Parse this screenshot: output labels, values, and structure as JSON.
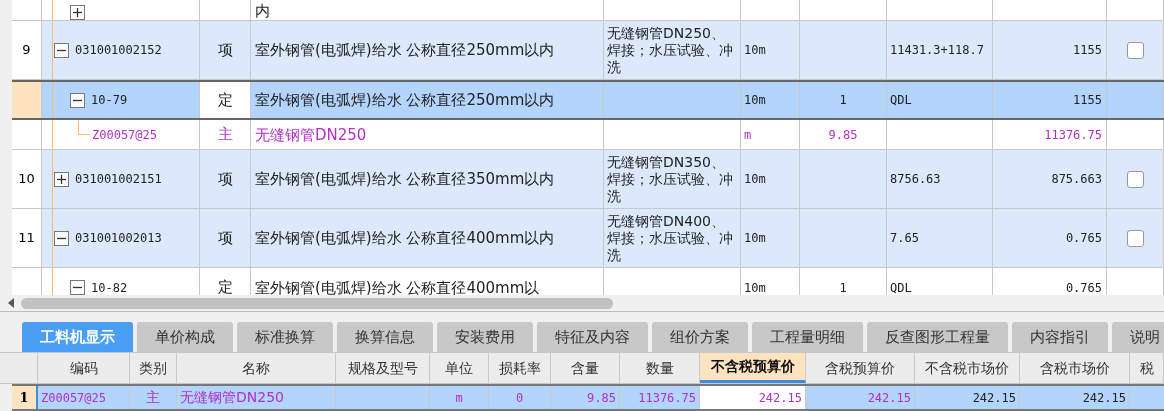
{
  "grid": {
    "rows": [
      {
        "kind": "quota",
        "selected": false,
        "expanded": false,
        "name": "内"
      },
      {
        "kind": "item",
        "number": "9",
        "code": "031001002152",
        "selected": false,
        "expanded": true,
        "checked": false,
        "type": "项",
        "name": "室外钢管(电弧焊)给水 公称直径250mm以内",
        "feature": "无缝钢管DN250、焊接；水压试验、冲洗",
        "unit": "10m",
        "expr": "11431.3+118.7",
        "amount": "1155",
        "children": [
          {
            "kind": "quota",
            "code": "10-79",
            "selected": true,
            "expanded": true,
            "type": "定",
            "name": "室外钢管(电弧焊)给水 公称直径250mm以内",
            "unit": "10m",
            "qty": "1",
            "expr": "QDL",
            "amount": "1155",
            "children": [
              {
                "kind": "material",
                "code": "Z00057@25",
                "selected": false,
                "type": "主",
                "name": "无缝钢管DN250",
                "unit": "m",
                "qty": "9.85",
                "amount": "11376.75"
              }
            ]
          }
        ]
      },
      {
        "kind": "item",
        "number": "10",
        "code": "031001002151",
        "selected": false,
        "expanded": false,
        "checked": false,
        "type": "项",
        "name": "室外钢管(电弧焊)给水 公称直径350mm以内",
        "feature": "无缝钢管DN350、焊接；水压试验、冲洗",
        "unit": "10m",
        "expr": "8756.63",
        "amount": "875.663"
      },
      {
        "kind": "item",
        "number": "11",
        "code": "031001002013",
        "selected": false,
        "expanded": true,
        "checked": false,
        "type": "项",
        "name": "室外钢管(电弧焊)给水 公称直径400mm以内",
        "feature": "无缝钢管DN400、焊接；水压试验、冲洗",
        "unit": "10m",
        "expr": "7.65",
        "amount": "0.765",
        "children": [
          {
            "kind": "quota",
            "code": "10-82",
            "selected": false,
            "expanded": true,
            "type": "定",
            "name": "室外钢管(电弧焊)给水 公称直径400mm以",
            "unit": "10m",
            "qty": "1",
            "expr": "QDL",
            "amount": "0.765"
          }
        ]
      }
    ]
  },
  "tabs": [
    {
      "label": "工料机显示",
      "selected": true
    },
    {
      "label": "单价构成",
      "selected": false
    },
    {
      "label": "标准换算",
      "selected": false
    },
    {
      "label": "换算信息",
      "selected": false
    },
    {
      "label": "安装费用",
      "selected": false
    },
    {
      "label": "特征及内容",
      "selected": false
    },
    {
      "label": "组价方案",
      "selected": false
    },
    {
      "label": "工程量明细",
      "selected": false
    },
    {
      "label": "反查图形工程量",
      "selected": false
    },
    {
      "label": "内容指引",
      "selected": false
    },
    {
      "label": "说明",
      "selected": false
    }
  ],
  "detail": {
    "columns": [
      {
        "label": "编码",
        "selected": false
      },
      {
        "label": "类别",
        "selected": false
      },
      {
        "label": "名称",
        "selected": false
      },
      {
        "label": "规格及型号",
        "selected": false
      },
      {
        "label": "单位",
        "selected": false
      },
      {
        "label": "损耗率",
        "selected": false
      },
      {
        "label": "含量",
        "selected": false
      },
      {
        "label": "数量",
        "selected": false
      },
      {
        "label": "不含税预算价",
        "selected": true
      },
      {
        "label": "含税预算价",
        "selected": false
      },
      {
        "label": "不含税市场价",
        "selected": false
      },
      {
        "label": "含税市场价",
        "selected": false
      },
      {
        "label": "税",
        "selected": false
      }
    ],
    "rows": [
      {
        "number": "1",
        "kind": "material",
        "selected": true,
        "cells": [
          {
            "text": "Z00057@25",
            "highlighted": true
          },
          {
            "text": "主",
            "highlighted": true
          },
          {
            "text": "无缝钢管DN250",
            "highlighted": true
          },
          {
            "text": ""
          },
          {
            "text": "m",
            "highlighted": true
          },
          {
            "text": "0",
            "highlighted": true
          },
          {
            "text": "9.85",
            "highlighted": true
          },
          {
            "text": "11376.75",
            "highlighted": true
          },
          {
            "text": "242.15",
            "highlighted": true
          },
          {
            "text": "242.15",
            "highlighted": true
          },
          {
            "text": "242.15",
            "highlighted": false
          },
          {
            "text": "242.15",
            "highlighted": false
          }
        ]
      }
    ]
  }
}
